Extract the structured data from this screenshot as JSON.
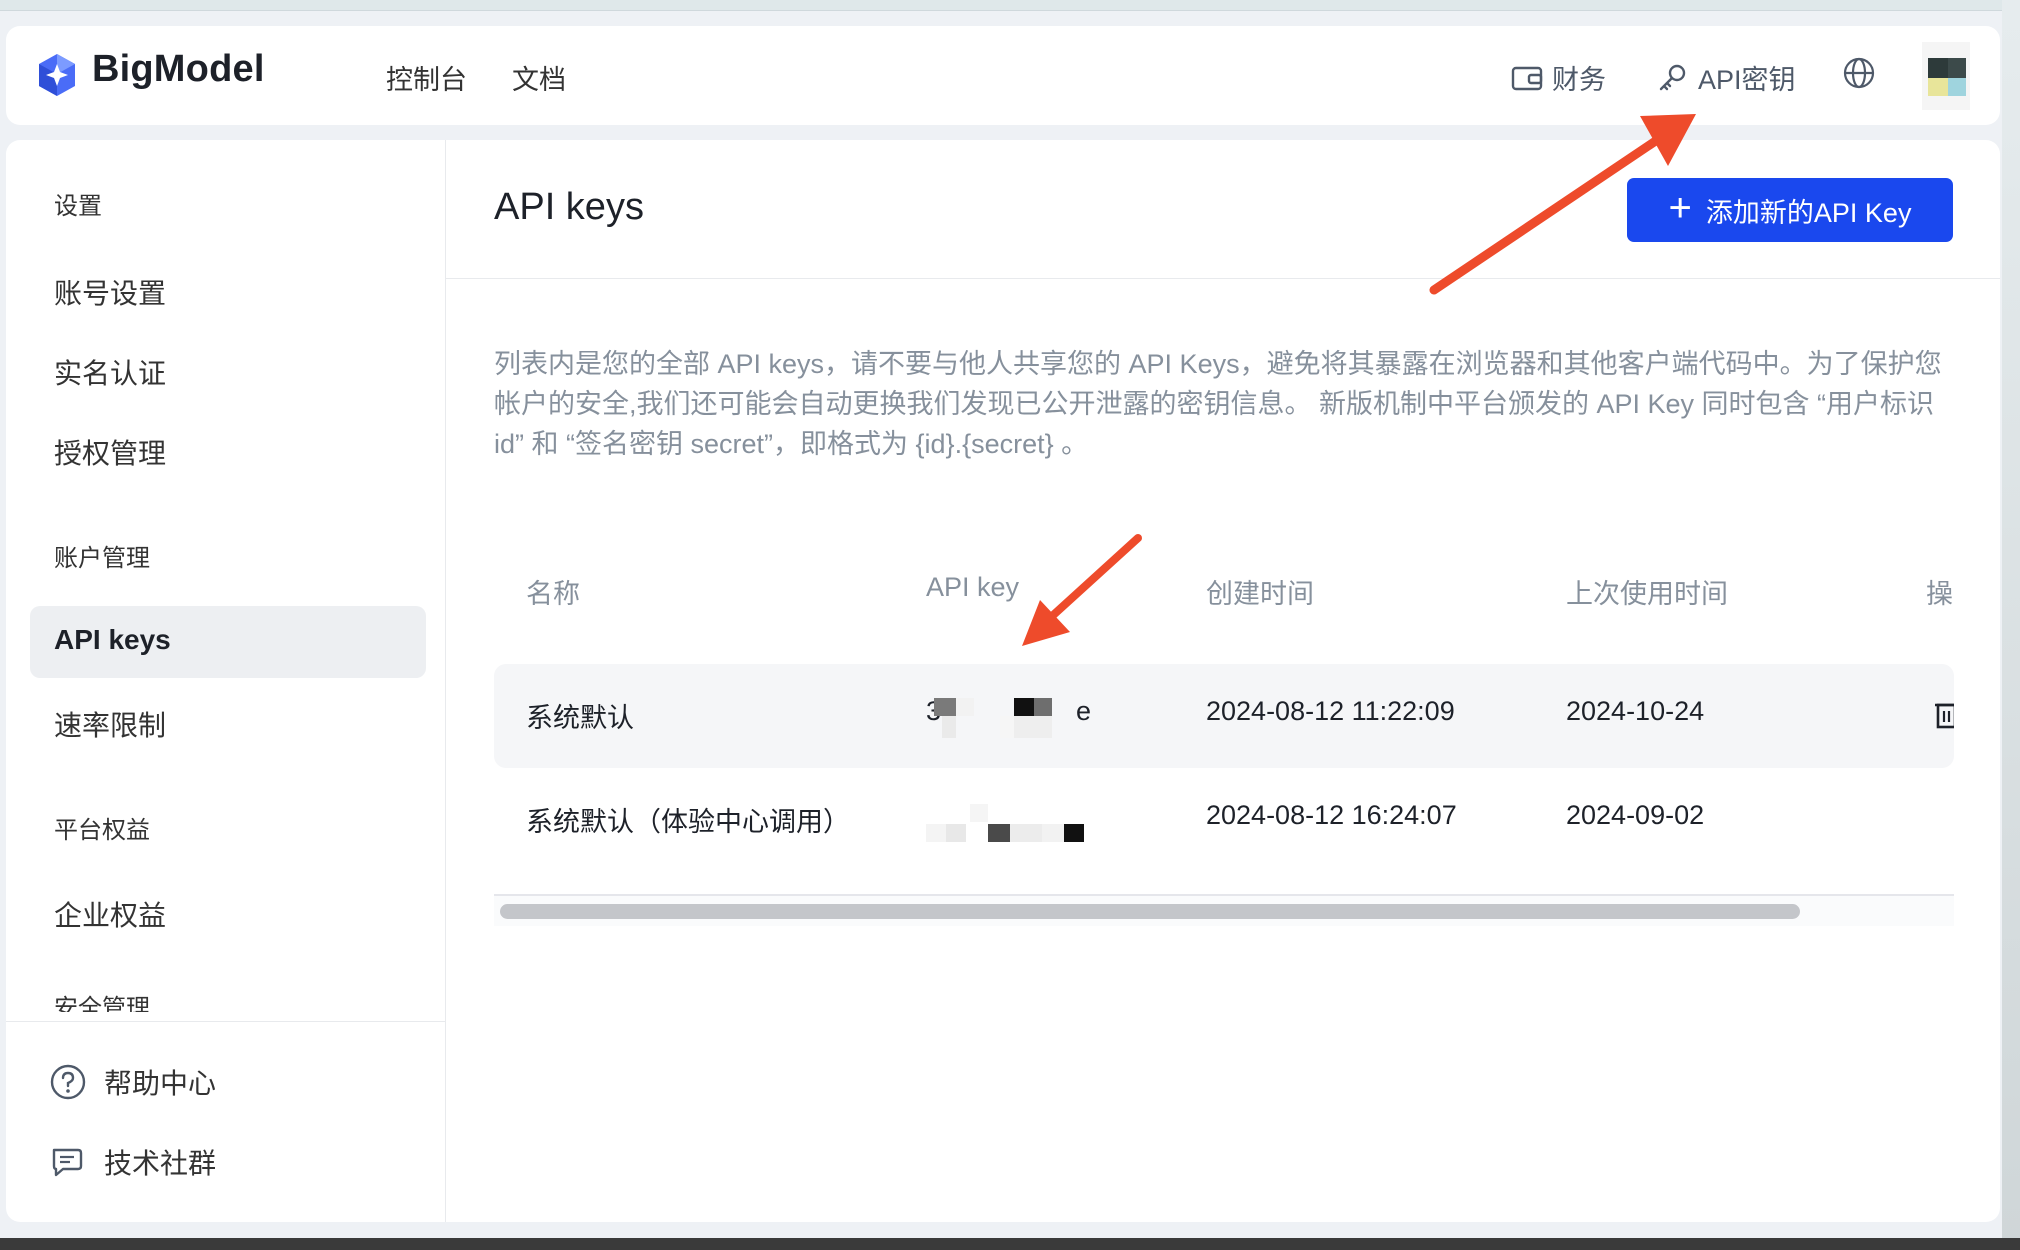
{
  "header": {
    "brand": "BigModel",
    "nav": [
      "控制台",
      "文档"
    ],
    "finance_label": "财务",
    "api_key_label": "API密钥"
  },
  "sidebar": {
    "groups": {
      "settings": "设置",
      "account_mgmt": "账户管理",
      "platform_benefits": "平台权益",
      "security_mgmt": "安全管理"
    },
    "items": {
      "account_settings": "账号设置",
      "real_name": "实名认证",
      "auth_mgmt": "授权管理",
      "api_keys": "API keys",
      "rate_limit": "速率限制",
      "enterprise_benefits": "企业权益"
    },
    "footer": {
      "help": "帮助中心",
      "community": "技术社群"
    }
  },
  "main": {
    "title": "API keys",
    "add_button": "添加新的API Key",
    "description": "列表内是您的全部 API keys，请不要与他人共享您的 API Keys，避免将其暴露在浏览器和其他客户端代码中。为了保护您帐户的安全,我们还可能会自动更换我们发现已公开泄露的密钥信息。 新版机制中平台颁发的 API Key 同时包含 “用户标识 id” 和 “签名密钥 secret”，即格式为 {id}.{secret} 。"
  },
  "table": {
    "columns": [
      "名称",
      "API key",
      "创建时间",
      "上次使用时间",
      "操"
    ],
    "rows": [
      {
        "name": "系统默认",
        "key_prefix": "3",
        "key_suffix": "e",
        "created": "2024-08-12 11:22:09",
        "last_used": "2024-10-24"
      },
      {
        "name": "系统默认（体验中心调用）",
        "key_prefix": "",
        "key_suffix": "",
        "created": "2024-08-12 16:24:07",
        "last_used": "2024-09-02"
      }
    ]
  },
  "colors": {
    "primary": "#1a48ee",
    "annotation_arrow": "#ee4b2b",
    "muted_text": "#86909c"
  },
  "icons": [
    "brand-logo-icon",
    "wallet-icon",
    "key-icon",
    "globe-icon",
    "plus-icon",
    "trash-icon",
    "help-icon",
    "chat-icon"
  ]
}
